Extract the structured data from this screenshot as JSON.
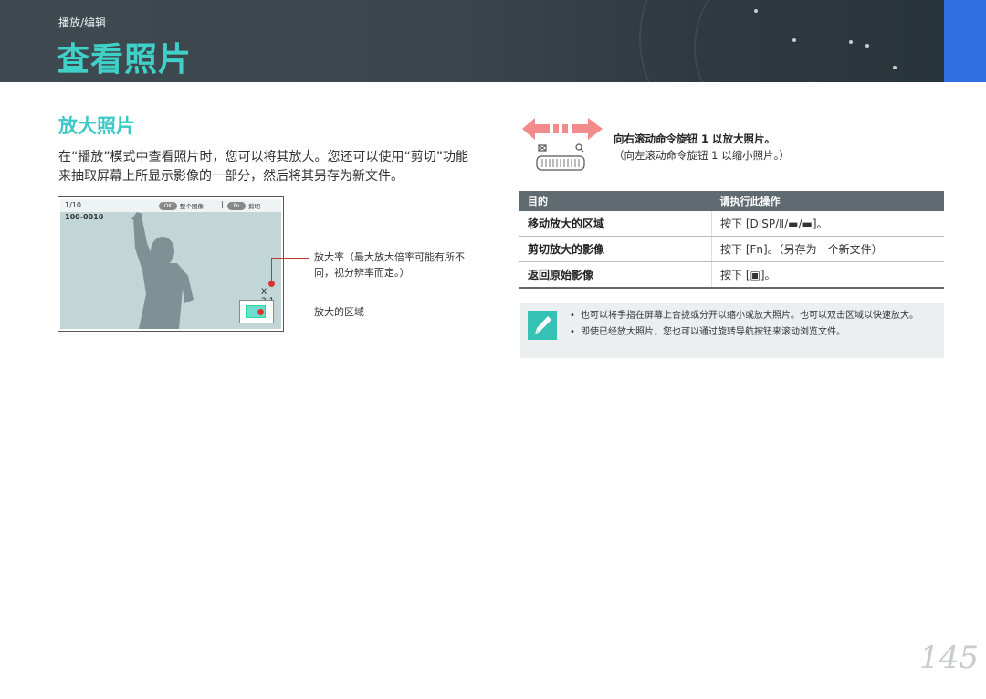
{
  "header": {
    "breadcrumb": "播放/编辑",
    "title": "查看照片"
  },
  "section": {
    "title": "放大照片",
    "intro": "在“播放”模式中查看照片时，您可以将其放大。您还可以使用“剪切”功能来抽取屏幕上所显示影像的一部分，然后将其另存为新文件。"
  },
  "camera_screen": {
    "counter": "1/10",
    "file_number": "100-0010",
    "ok_label": "OK",
    "ok_action": "整个图像",
    "fn_label": "Fn",
    "fn_action": "剪切",
    "zoom": "X 2.1"
  },
  "callouts": {
    "zoom_ratio": "放大率（最大放大倍率可能有所不同，视分辨率而定。）",
    "zoomed_area": "放大的区域"
  },
  "dial_instruction": {
    "main": "向右滚动命令旋钮 1 以放大照片。",
    "sub": "（向左滚动命令旋钮 1 以缩小照片。）"
  },
  "table": {
    "headers": [
      "目的",
      "请执行此操作"
    ],
    "rows": [
      {
        "purpose": "移动放大的区域",
        "action": "按下 [DISP/Ⅱ/▬/▬]。"
      },
      {
        "purpose": "剪切放大的影像",
        "action": "按下 [Fn]。（另存为一个新文件）"
      },
      {
        "purpose": "返回原始影像",
        "action": "按下 [▣]。"
      }
    ]
  },
  "notes": [
    "也可以将手指在屏幕上合拢或分开以缩小或放大照片。也可以双击区域以快速放大。",
    "即使已经放大照片，您也可以通过旋转导航按钮来滚动浏览文件。"
  ],
  "page_number": "145",
  "icons": {
    "note": "pencil-icon",
    "dial": "command-dial-icon"
  },
  "colors": {
    "title": "#3fd0c8",
    "section_title": "#3cc8c4",
    "header_bg": "#3a464c",
    "table_header": "#5f6b70",
    "side_tab": "#2f6fe0",
    "arrow": "#f28b8b"
  }
}
